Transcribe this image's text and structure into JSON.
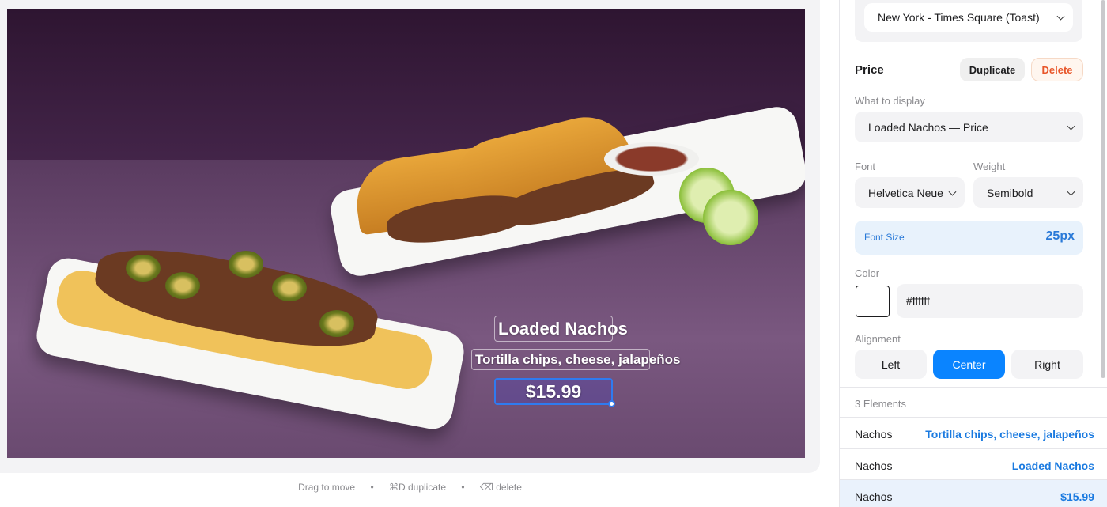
{
  "location": {
    "selected": "New York - Times Square (Toast)"
  },
  "canvas": {
    "title_text": "Loaded Nachos",
    "description_text": "Tortilla chips, cheese, jalapeños",
    "price_text": "$15.99"
  },
  "hints": {
    "move": "Drag to move",
    "duplicate": "⌘D duplicate",
    "delete": "⌫ delete",
    "separator": "•"
  },
  "inspector": {
    "section_title": "Price",
    "duplicate_label": "Duplicate",
    "delete_label": "Delete",
    "display_label": "What to display",
    "display_value": "Loaded Nachos — Price",
    "font_label": "Font",
    "font_value": "Helvetica Neue",
    "weight_label": "Weight",
    "weight_value": "Semibold",
    "font_size_label": "Font Size",
    "font_size_value": "25px",
    "color_label": "Color",
    "color_value": "#ffffff",
    "alignment_label": "Alignment",
    "alignment_options": [
      "Left",
      "Center",
      "Right"
    ],
    "alignment_selected": "Center"
  },
  "elements": {
    "count_label": "3 Elements",
    "rows": [
      {
        "name": "Nachos",
        "value": "Tortilla chips, cheese, jalapeños"
      },
      {
        "name": "Nachos",
        "value": "Loaded Nachos"
      },
      {
        "name": "Nachos",
        "value": "$15.99"
      }
    ]
  },
  "colors": {
    "accent": "#0a84ff",
    "delete": "#e8562a",
    "link": "#1a7ae0"
  }
}
